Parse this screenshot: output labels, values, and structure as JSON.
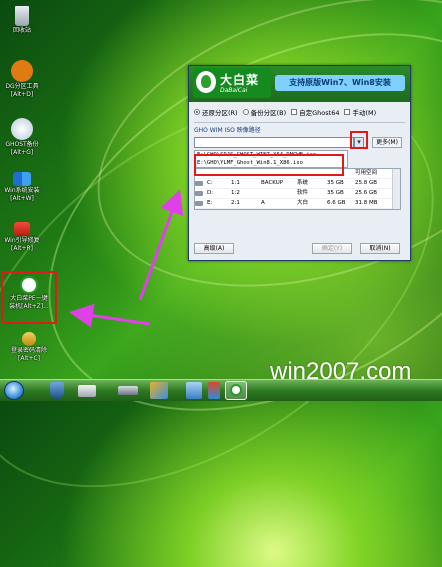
{
  "desktop_icons": [
    {
      "label": "回收站",
      "hotkey": ""
    },
    {
      "label": "DG分区工具",
      "hotkey": "[Alt+D]"
    },
    {
      "label": "GHOST备份",
      "hotkey": "[Alt+G]"
    },
    {
      "label": "Win系统安装",
      "hotkey": "[Alt+W]"
    },
    {
      "label": "Win引导修复",
      "hotkey": "[Alt+R]"
    },
    {
      "label": "大白菜PE一键",
      "hotkey": "装机[Alt+Z]..."
    },
    {
      "label": "登录密码清除",
      "hotkey": "[Alt+C]"
    }
  ],
  "window": {
    "logo_title": "大白菜",
    "logo_sub": "DaBaiCai",
    "badge": "支持原版Win7、Win8安装",
    "options": {
      "restore": "还原分区(R)",
      "backup": "备份分区(B)",
      "custom_ghost": "自定Ghost64",
      "manual": "手动(M)"
    },
    "path_label": "GHO WIM ISO 映像路径",
    "more_button": "更多(M)",
    "dropdown_items": [
      "E:\\GHO\\SDJS_GHOST_WIN7_X64_DNCWB.iso",
      "E:\\GHO\\YLMF_Ghost_Win8.1_X86.iso"
    ],
    "table": {
      "header_tail": "可用空间",
      "rows": [
        {
          "drive": "C:",
          "index": "1:1",
          "name": "BACKUP",
          "label": "系统",
          "total": "35 GB",
          "free": "25.8 GB"
        },
        {
          "drive": "D:",
          "index": "1:2",
          "name": "",
          "label": "软件",
          "total": "35 GB",
          "free": "25.6 GB"
        },
        {
          "drive": "E:",
          "index": "2:1",
          "name": "A",
          "label": "大白",
          "total": "6.6 GB",
          "free": "31.8 MB"
        }
      ]
    },
    "buttons": {
      "advanced": "高级(A)",
      "ok": "确定(Y)",
      "cancel": "取消(N)"
    }
  },
  "watermark": "win2007.com",
  "colors": {
    "highlight": "#e0191b",
    "arrow": "#e040e8"
  },
  "taskbar": {
    "icons": [
      "start-orb",
      "shield",
      "printer",
      "drive",
      "apps",
      "window",
      "flag",
      "dabaicai"
    ]
  }
}
